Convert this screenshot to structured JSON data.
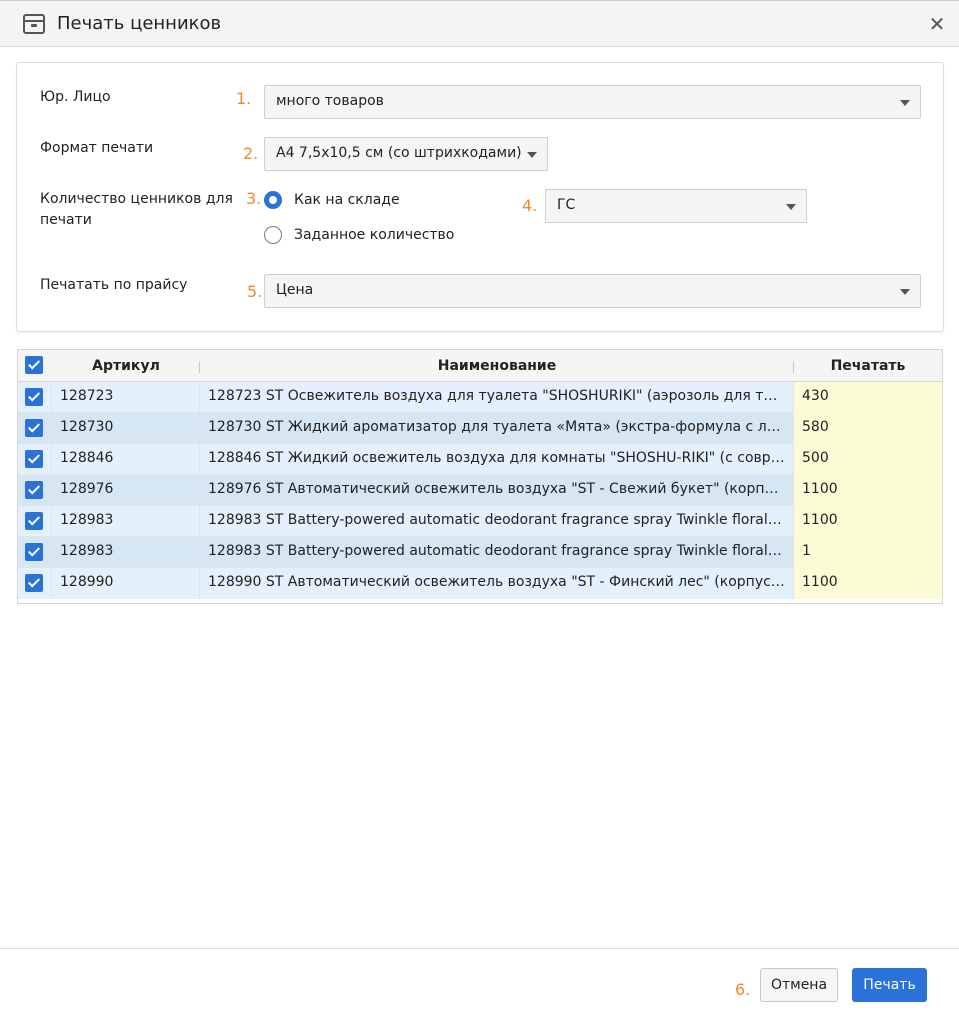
{
  "dialog": {
    "title": "Печать ценников",
    "title_icon": "box-icon",
    "close_glyph": "✕"
  },
  "form": {
    "legal_entity": {
      "label": "Юр. Лицо",
      "marker": "1.",
      "value": "много товаров"
    },
    "print_format": {
      "label": "Формат печати",
      "marker": "2.",
      "value": "А4 7,5х10,5 см (со штрихкодами)"
    },
    "quantity": {
      "label_line1": "Количество ценников для",
      "label_line2": "печати",
      "marker": "3.",
      "options": [
        {
          "label": "Как на складе",
          "selected": true
        },
        {
          "label": "Заданное количество",
          "selected": false
        }
      ]
    },
    "warehouse": {
      "marker": "4.",
      "value": "ГС"
    },
    "price_list": {
      "label": "Печатать по прайсу",
      "marker": "5.",
      "value": "Цена"
    }
  },
  "table": {
    "columns": [
      "Артикул",
      "Наименование",
      "Печатать"
    ],
    "all_checked": true,
    "rows": [
      {
        "checked": true,
        "article": "128723",
        "name": "128723 ST Освежитель воздуха для туалета \"SHOSHURIKI\" (аэрозоль для туалета)",
        "qty": "430"
      },
      {
        "checked": true,
        "article": "128730",
        "name": "128730 ST Жидкий ароматизатор для туалета «Мята» (экстра-формула с лимоном)",
        "qty": "580"
      },
      {
        "checked": true,
        "article": "128846",
        "name": "128846 ST Жидкий освежитель воздуха для комнаты \"SHOSHU-RIKI\" (с современным ароматом)",
        "qty": "500"
      },
      {
        "checked": true,
        "article": "128976",
        "name": "128976 ST Автоматический освежитель воздуха \"ST - Свежий букет\" (корпус + баллон)",
        "qty": "1100"
      },
      {
        "checked": true,
        "article": "128983",
        "name": "128983 ST Battery-powered automatic deodorant fragrance spray Twinkle floral\" (set)",
        "qty": "1100"
      },
      {
        "checked": true,
        "article": "128983",
        "name": "128983 ST Battery-powered automatic deodorant fragrance spray Twinkle floral\" (set)",
        "qty": "1"
      },
      {
        "checked": true,
        "article": "128990",
        "name": "128990 ST Автоматический освежитель воздуха \"ST - Финский лес\" (корпус + баллон)",
        "qty": "1100"
      }
    ]
  },
  "footer": {
    "marker": "6.",
    "cancel_label": "Отмена",
    "print_label": "Печать"
  },
  "colors": {
    "accent": "#2a72d8",
    "marker": "#f0892e",
    "qty_cell": "#fbfbd6",
    "row_a": "#e4f0fb",
    "row_b": "#d7e6f3"
  }
}
